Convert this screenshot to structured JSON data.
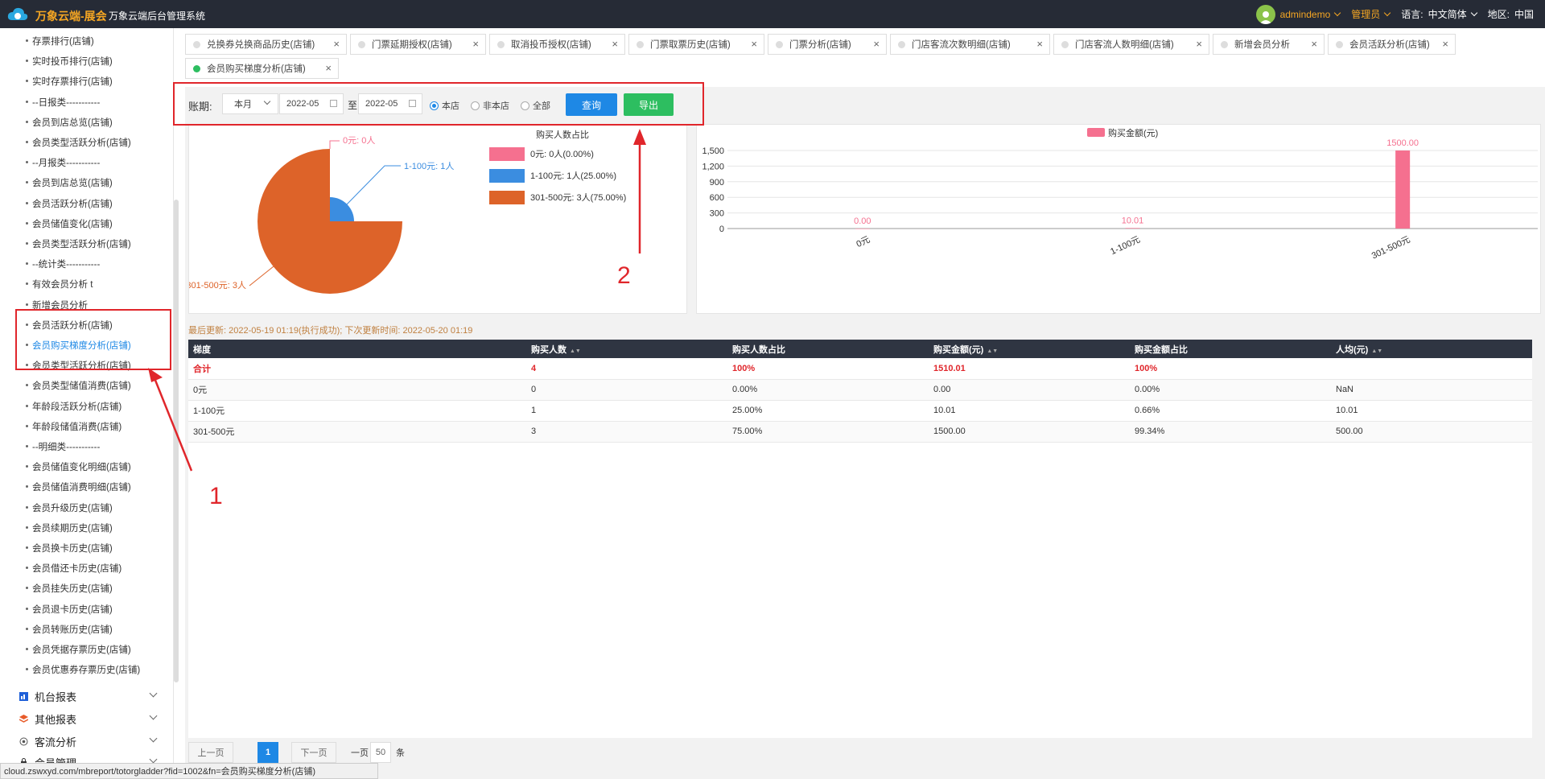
{
  "header": {
    "brand": "万象云端-展会",
    "system_name": "万象云端后台管理系统",
    "username": "admindemo",
    "role": "管理员",
    "lang_label": "语言:",
    "lang_value": "中文简体",
    "region_label": "地区:",
    "region_value": "中国"
  },
  "sidebar": {
    "items": [
      "存票排行(店铺)",
      "实时投币排行(店铺)",
      "实时存票排行(店铺)",
      "--日报类-----------",
      "会员到店总览(店铺)",
      "会员类型活跃分析(店铺)",
      "--月报类-----------",
      "会员到店总览(店铺)",
      "会员活跃分析(店铺)",
      "会员储值变化(店铺)",
      "会员类型活跃分析(店铺)",
      "--统计类-----------",
      "有效会员分析 t",
      "新增会员分析",
      "会员活跃分析(店铺)",
      "会员购买梯度分析(店铺)",
      "会员类型活跃分析(店铺)",
      "会员类型储值消费(店铺)",
      "年龄段活跃分析(店铺)",
      "年龄段储值消费(店铺)",
      "--明细类-----------",
      "会员储值变化明细(店铺)",
      "会员储值消费明细(店铺)",
      "会员升级历史(店铺)",
      "会员续期历史(店铺)",
      "会员换卡历史(店铺)",
      "会员借还卡历史(店铺)",
      "会员挂失历史(店铺)",
      "会员退卡历史(店铺)",
      "会员转账历史(店铺)",
      "会员凭据存票历史(店铺)",
      "会员优惠券存票历史(店铺)"
    ],
    "active_index": 15,
    "groups": [
      "机台报表",
      "其他报表",
      "客流分析",
      "会员管理"
    ]
  },
  "tabs": [
    "兑换券兑换商品历史(店铺)",
    "门票延期授权(店铺)",
    "取消投币授权(店铺)",
    "门票取票历史(店铺)",
    "门票分析(店铺)",
    "门店客流次数明细(店铺)",
    "门店客流人数明细(店铺)",
    "新增会员分析",
    "会员活跃分析(店铺)",
    "会员购买梯度分析(店铺)"
  ],
  "filter": {
    "label": "账期:",
    "period": "本月",
    "from": "2022-05",
    "to_label": "至",
    "to": "2022-05",
    "radios": [
      "本店",
      "非本店",
      "全部"
    ],
    "selected_radio": 0,
    "query_label": "查询",
    "export_label": "导出"
  },
  "colors": {
    "topbar": "#262b36",
    "brand": "#f5a623",
    "accent_blue": "#1e88e5",
    "export_green": "#2dbe60",
    "annotation_red": "#e0262b",
    "pie_pink": "#f5708f",
    "pie_blue": "#3b8de0",
    "pie_orange": "#dd6329",
    "bar_pink": "#f5708f"
  },
  "chart_data": [
    {
      "type": "pie",
      "title": "购买人数占比",
      "labels": [
        "0元",
        "1-100元",
        "301-500元"
      ],
      "values": [
        0,
        1,
        3
      ],
      "slice_labels": [
        "0元: 0人",
        "1-100元: 1人",
        "301-500元: 3人"
      ],
      "legend": [
        "0元: 0人(0.00%)",
        "1-100元: 1人(25.00%)",
        "301-500元: 3人(75.00%)"
      ],
      "legend_placement": "right"
    },
    {
      "type": "bar",
      "title": "",
      "legend": [
        "购买金额(元)"
      ],
      "legend_placement": "top",
      "categories": [
        "0元",
        "1-100元",
        "301-500元"
      ],
      "values": [
        0,
        10.01,
        1500
      ],
      "data_labels": [
        "0.00",
        "10.01",
        "1500.00"
      ],
      "yticks": [
        "0",
        "300",
        "600",
        "900",
        "1,200",
        "1,500"
      ],
      "ylim": [
        0,
        1500
      ],
      "grid": true
    }
  ],
  "update_line": "最后更新: 2022-05-19 01:19(执行成功); 下次更新时间: 2022-05-20 01:19",
  "table": {
    "headers": [
      "梯度",
      "购买人数",
      "购买人数占比",
      "购买金额(元)",
      "购买金额占比",
      "人均(元)"
    ],
    "rows": [
      [
        "合计",
        "4",
        "100%",
        "1510.01",
        "100%",
        ""
      ],
      [
        "0元",
        "0",
        "0.00%",
        "0.00",
        "0.00%",
        "NaN"
      ],
      [
        "1-100元",
        "1",
        "25.00%",
        "10.01",
        "0.66%",
        "10.01"
      ],
      [
        "301-500元",
        "3",
        "75.00%",
        "1500.00",
        "99.34%",
        "500.00"
      ]
    ]
  },
  "pager": {
    "prev": "上一页",
    "page": "1",
    "next": "下一页",
    "per_page_label": "一页",
    "per_page": "50",
    "unit": "条"
  },
  "statusbar": "cloud.zswxyd.com/mbreport/totorgladder?fid=1002&fn=会员购买梯度分析(店铺)",
  "annotations": [
    "1",
    "2"
  ]
}
